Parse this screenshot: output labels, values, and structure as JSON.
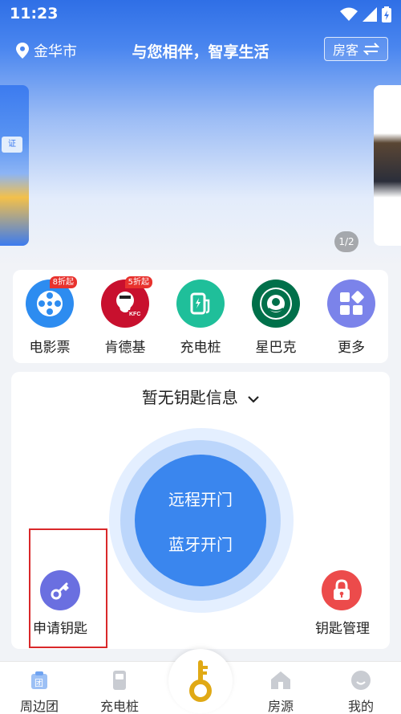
{
  "status": {
    "time": "11:23"
  },
  "header": {
    "city": "金华市",
    "slogan": "与您相伴，智享生活",
    "role_label": "房客"
  },
  "banner": {
    "pager": "1/2",
    "left_chip": "证"
  },
  "quick_menu": [
    {
      "label": "电影票",
      "badge": "8折起",
      "icon": "film-reel-icon",
      "color": "#2d8cf0"
    },
    {
      "label": "肯德基",
      "badge": "5折起",
      "icon": "kfc-logo-icon",
      "color": "#c8102e"
    },
    {
      "label": "充电桩",
      "badge": "",
      "icon": "ev-charger-icon",
      "color": "#1fbf9a"
    },
    {
      "label": "星巴克",
      "badge": "",
      "icon": "starbucks-logo-icon",
      "color": "#00704a"
    },
    {
      "label": "更多",
      "badge": "",
      "icon": "more-grid-icon",
      "color": "#7b83ea"
    }
  ],
  "key_panel": {
    "title": "暂无钥匙信息",
    "remote_open": "远程开门",
    "bluetooth_open": "蓝牙开门",
    "apply_key": "申请钥匙",
    "key_manage": "钥匙管理"
  },
  "tabbar": {
    "tabs": [
      "周边团",
      "充电桩",
      "房源",
      "我的"
    ]
  },
  "colors": {
    "primary": "#3a86ee",
    "highlight_border": "#d9282a"
  }
}
